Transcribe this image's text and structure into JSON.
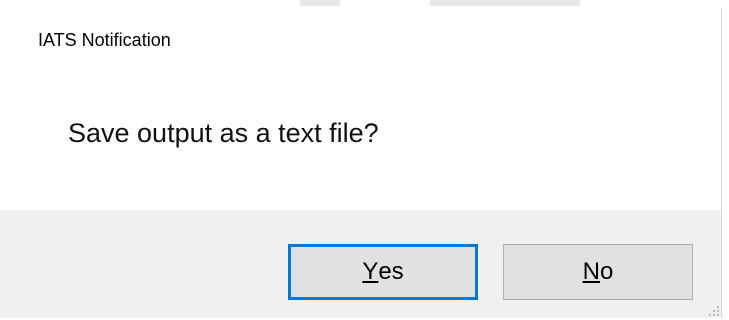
{
  "dialog": {
    "title": "IATS Notification",
    "message": "Save output as a text file?"
  },
  "buttons": {
    "yes": {
      "accel": "Y",
      "rest": "es"
    },
    "no": {
      "accel": "N",
      "rest": "o"
    }
  },
  "colors": {
    "focus_border": "#0078d7",
    "button_face": "#e1e1e1",
    "button_area": "#f0f0f0"
  },
  "icons": {
    "grip": "resize-grip-icon"
  }
}
